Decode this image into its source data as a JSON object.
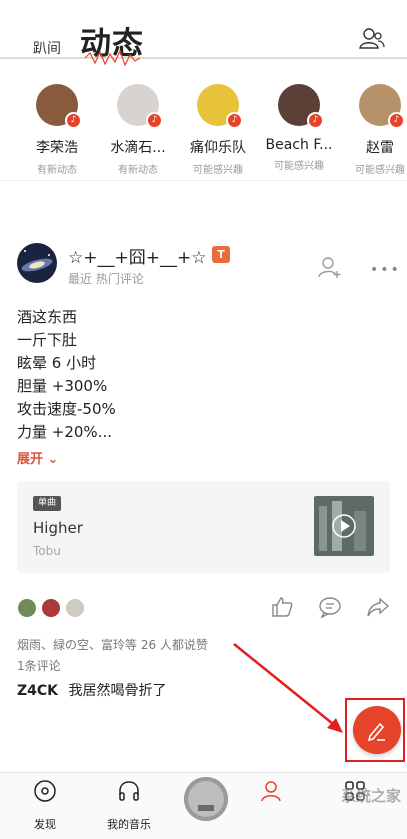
{
  "header": {
    "tab_small": "趴间",
    "tab_big": "动态",
    "friends_icon": "friends-icon"
  },
  "recommendations": [
    {
      "name": "李荣浩",
      "sub": "有新动态",
      "avatar_color": "#8a5a3c"
    },
    {
      "name": "水滴石...",
      "sub": "有新动态",
      "avatar_color": "#d9d3cf"
    },
    {
      "name": "痛仰乐队",
      "sub": "可能感兴趣",
      "avatar_color": "#e7c23a"
    },
    {
      "name": "Beach F...",
      "sub": "可能感兴趣",
      "avatar_color": "#5c4038"
    },
    {
      "name": "赵雷",
      "sub": "可能感兴趣",
      "avatar_color": "#b5926a"
    }
  ],
  "post": {
    "user_name": "☆+__+囧+__+☆",
    "tag": "T",
    "meta": "最近 热门评论",
    "lines": [
      "酒这东西",
      "一斤下肚",
      "眩晕 6 小时",
      "胆量 +300%",
      "攻击速度-50%",
      "力量 +20%..."
    ],
    "expand_label": "展开 ⌄",
    "song": {
      "tag": "单曲",
      "title": "Higher",
      "artist": "Tobu"
    },
    "likes_text": "烟雨、緑の空、富玲等 26 人都说赞",
    "comment_count": "1条评论",
    "comment": {
      "user": "Z4CK",
      "text": "我居然喝骨折了"
    }
  },
  "nav": {
    "items": [
      {
        "label": "发现",
        "icon": "discover-icon"
      },
      {
        "label": "我的音乐",
        "icon": "headphones-icon"
      },
      {
        "label": "",
        "icon": "now-playing-cover"
      },
      {
        "label": "",
        "icon": "friends-tab-icon"
      },
      {
        "label": "",
        "icon": "account-icon"
      }
    ],
    "watermark": "系统之家"
  },
  "colors": {
    "accent": "#e5432a",
    "highlight_box": "#e02020"
  }
}
